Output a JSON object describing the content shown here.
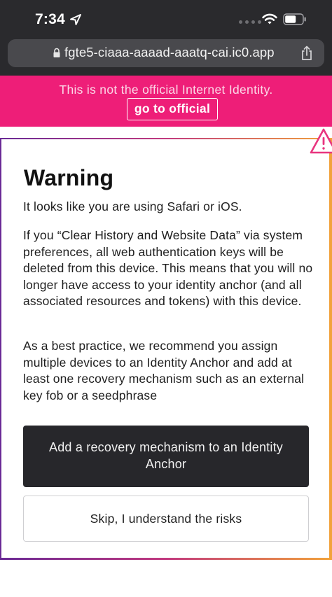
{
  "status_bar": {
    "time": "7:34"
  },
  "browser": {
    "url": "fgte5-ciaaa-aaaad-aaatq-cai.ic0.app"
  },
  "banner": {
    "text": "This is not the official Internet Identity.",
    "link_label": "go to official"
  },
  "warning": {
    "title": "Warning",
    "paragraphs": [
      "It looks like you are using Safari or iOS.",
      "If you “Clear History and Website Data” via system preferences, all web authentication keys will be deleted from this device. This means that you will no longer have access to your identity anchor (and all associated resources and tokens) with this device.",
      "As a best practice, we recommend you assign multiple devices to an Identity Anchor and add at least one recovery mechanism such as an external key fob or a seedphrase"
    ],
    "primary_button": "Add a recovery mechanism to an Identity Anchor",
    "secondary_button": "Skip, I understand the risks"
  },
  "colors": {
    "banner": "#ee1e78",
    "primary_button": "#27272b",
    "gradient": [
      "#6a2a96",
      "#c23a7f",
      "#f2a33a"
    ]
  },
  "icons": [
    "location-arrow-icon",
    "signal-dots-icon",
    "wifi-icon",
    "battery-icon",
    "lock-icon",
    "share-icon",
    "warning-triangle-icon"
  ]
}
